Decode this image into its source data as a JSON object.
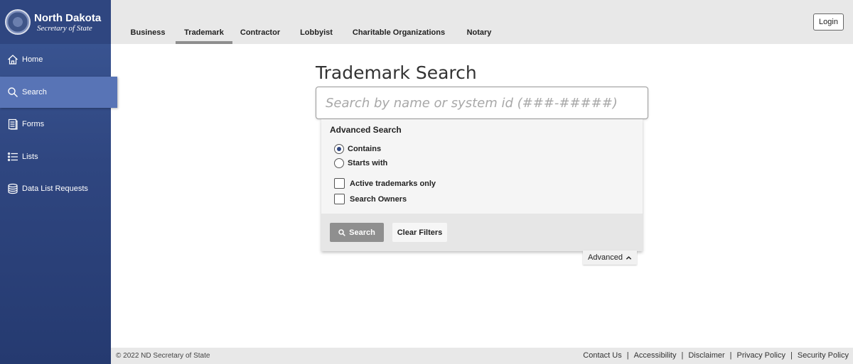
{
  "brand": {
    "title": "North Dakota",
    "subtitle": "Secretary of State"
  },
  "sidebar": {
    "items": [
      {
        "label": "Home",
        "icon": "home-icon"
      },
      {
        "label": "Search",
        "icon": "search-icon",
        "active": true
      },
      {
        "label": "Forms",
        "icon": "forms-icon"
      },
      {
        "label": "Lists",
        "icon": "list-icon"
      },
      {
        "label": "Data List Requests",
        "icon": "database-icon"
      }
    ]
  },
  "topbar": {
    "tabs": [
      {
        "label": "Business"
      },
      {
        "label": "Trademark",
        "active": true
      },
      {
        "label": "Contractor"
      },
      {
        "label": "Lobbyist"
      },
      {
        "label": "Charitable Organizations"
      },
      {
        "label": "Notary"
      }
    ],
    "login_label": "Login"
  },
  "main": {
    "title": "Trademark Search",
    "search_placeholder": "Search by name or system id (###-#####)",
    "advanced": {
      "title": "Advanced Search",
      "radios": [
        {
          "label": "Contains",
          "checked": true
        },
        {
          "label": "Starts with",
          "checked": false
        }
      ],
      "checkboxes": [
        {
          "label": "Active trademarks only",
          "checked": false
        },
        {
          "label": "Search Owners",
          "checked": false
        }
      ],
      "search_label": "Search",
      "clear_label": "Clear Filters",
      "toggle_label": "Advanced"
    }
  },
  "footer": {
    "copyright": "© 2022 ND Secretary of State",
    "links": [
      "Contact Us",
      "Accessibility",
      "Disclaimer",
      "Privacy Policy",
      "Security Policy"
    ]
  },
  "colors": {
    "sidebar": "#2f4680",
    "sidebar_active": "#5874b6",
    "topbar": "#e8e8e8"
  }
}
